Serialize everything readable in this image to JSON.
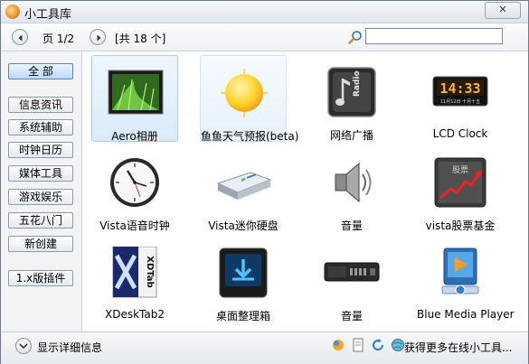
{
  "window": {
    "title": "小工具库",
    "close_label": "✕"
  },
  "toolbar": {
    "page_label": "页 1/2",
    "count_label": "[共 18 个]",
    "search_value": ""
  },
  "sidebar": {
    "items": [
      {
        "label": "全 部",
        "active": true
      },
      {
        "label": "信息资讯"
      },
      {
        "label": "系统辅助"
      },
      {
        "label": "时钟日历"
      },
      {
        "label": "媒体工具"
      },
      {
        "label": "游戏娱乐"
      },
      {
        "label": "五花八门"
      },
      {
        "label": "新创建"
      },
      {
        "label": "1.x版插件"
      }
    ]
  },
  "gadgets": [
    {
      "label": "Aero相册",
      "icon": "photo-album-icon"
    },
    {
      "label": "鱼鱼天气预报(beta)",
      "icon": "weather-sun-icon"
    },
    {
      "label": "网络广播",
      "icon": "radio-icon"
    },
    {
      "label": "LCD Clock",
      "icon": "lcd-clock-icon"
    },
    {
      "label": "Vista语音时钟",
      "icon": "wall-clock-icon"
    },
    {
      "label": "Vista迷你硬盘",
      "icon": "hard-drive-icon"
    },
    {
      "label": "音量",
      "icon": "speaker-icon"
    },
    {
      "label": "vista股票基金",
      "icon": "stock-chart-icon"
    },
    {
      "label": "XDeskTab2",
      "icon": "xdesktab-icon"
    },
    {
      "label": "桌面整理箱",
      "icon": "desktop-box-icon"
    },
    {
      "label": "音量",
      "icon": "volume-panel-icon"
    },
    {
      "label": "Blue Media Player",
      "icon": "media-player-icon"
    }
  ],
  "statusbar": {
    "details_label": "显示详细信息",
    "more_label": "获得更多在线小工具..."
  },
  "lcd_time": "14:33",
  "lcd_date": "11月12日 十月十五",
  "radio_text": "Radio",
  "stock_text": "股票",
  "xdesktab_text": "XDTab"
}
